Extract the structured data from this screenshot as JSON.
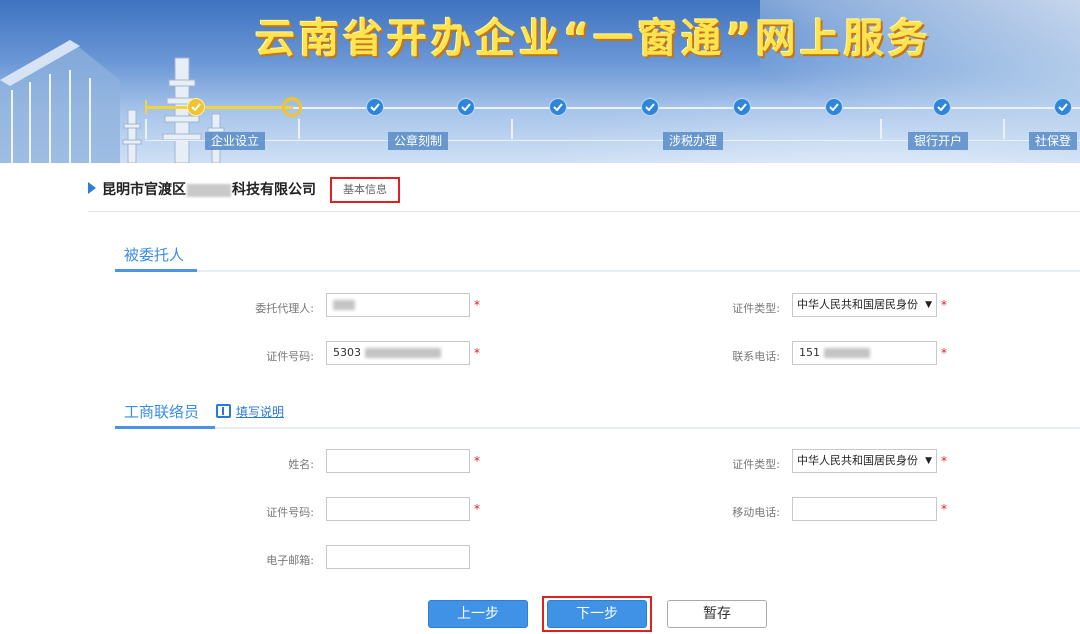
{
  "banner": {
    "title": "云南省开办企业“一窗通”网上服务"
  },
  "steps": {
    "stages": [
      "企业设立",
      "公章刻制",
      "涉税办理",
      "银行开户",
      "社保登"
    ]
  },
  "company": {
    "name_prefix": "昆明市官渡区",
    "name_suffix": "科技有限公司",
    "tag": "基本信息"
  },
  "section1": {
    "title": "被委托人",
    "fields": {
      "agent_label": "委托代理人:",
      "id_type_label": "证件类型:",
      "id_type_value": "中华人民共和国居民身份",
      "id_no_label": "证件号码:",
      "id_no_value": "5303",
      "phone_label": "联系电话:",
      "phone_value": "151"
    }
  },
  "section2": {
    "title": "工商联络员",
    "help": "填写说明",
    "fields": {
      "name_label": "姓名:",
      "id_type_label": "证件类型:",
      "id_type_value": "中华人民共和国居民身份",
      "id_no_label": "证件号码:",
      "mobile_label": "移动电话:",
      "email_label": "电子邮箱:"
    }
  },
  "required_mark": "*",
  "select_arrow": "▼",
  "buttons": {
    "prev": "上一步",
    "next": "下一步",
    "save": "暂存"
  },
  "colors": {
    "accent": "#3f92e6",
    "highlight_frame": "#e02020",
    "banner_title": "#ffe44d"
  }
}
